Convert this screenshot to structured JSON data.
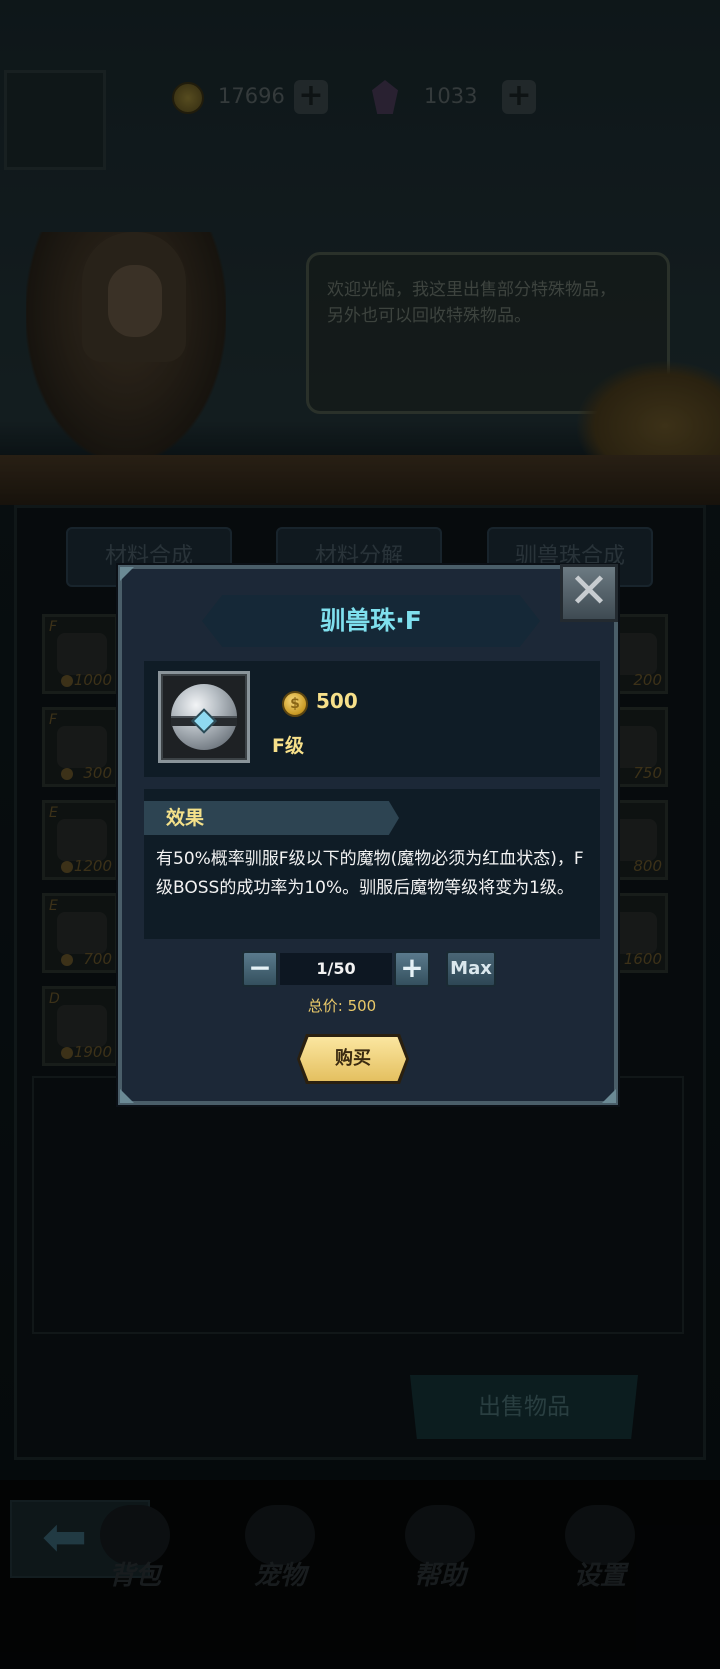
{
  "hud": {
    "gold": "17696",
    "gems": "1033"
  },
  "npc": {
    "dialogue_line1": "欢迎光临，我这里出售部分特殊物品，",
    "dialogue_line2": "另外也可以回收特殊物品。"
  },
  "tabs": [
    "材料合成",
    "材料分解",
    "驯兽珠合成"
  ],
  "shop_slots": {
    "left": [
      {
        "grade": "F",
        "price": "1000"
      },
      {
        "grade": "F",
        "price": "300"
      },
      {
        "grade": "E",
        "price": "1200"
      },
      {
        "grade": "E",
        "price": "700"
      },
      {
        "grade": "D",
        "price": "1900"
      }
    ],
    "right": [
      {
        "price": "200"
      },
      {
        "price": "750"
      },
      {
        "price": "800"
      },
      {
        "price": "1600"
      }
    ]
  },
  "sell_button": "出售物品",
  "bottom_nav": {
    "items": [
      "背包",
      "宠物",
      "帮助",
      "设置"
    ]
  },
  "modal": {
    "title": "驯兽珠·F",
    "close": "✕",
    "price": "500",
    "grade": "F级",
    "effect_title": "效果",
    "effect_text": "有50%概率驯服F级以下的魔物(魔物必须为红血状态)，F级BOSS的成功率为10%。驯服后魔物等级将变为1级。",
    "quantity": "1/50",
    "minus": "−",
    "plus": "+",
    "max": "Max",
    "total_label": "总价: 500",
    "buy": "购买"
  },
  "icons": {
    "back": "arrow-left-icon",
    "coin": "gold-coin-icon",
    "gem": "gem-icon"
  }
}
